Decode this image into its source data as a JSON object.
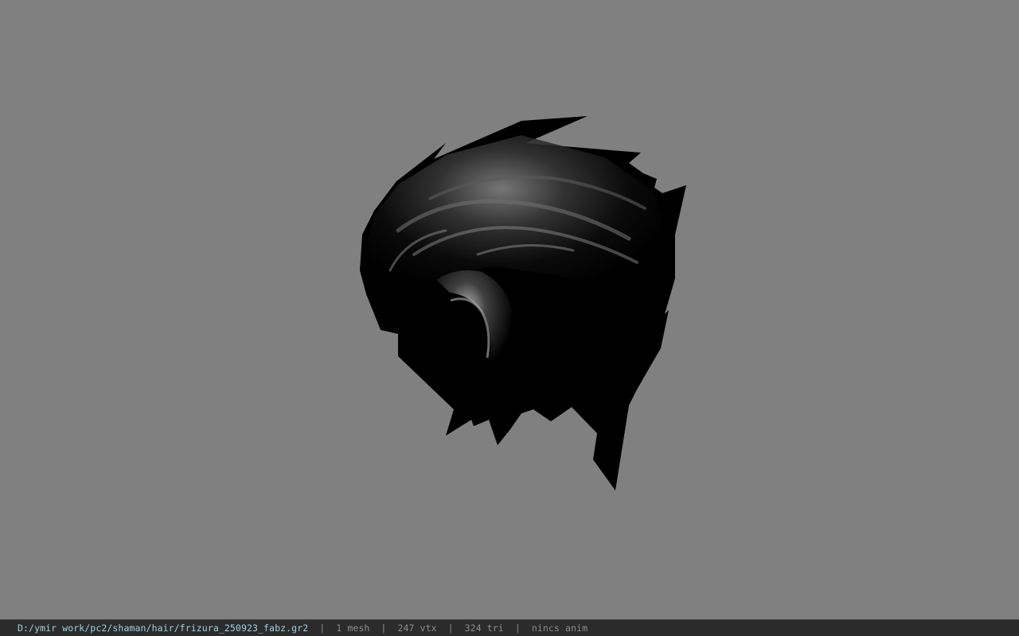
{
  "viewport": {
    "background": "#808080",
    "model": "hair mesh"
  },
  "status_bar": {
    "file_path": "D:/ymir work/pc2/shaman/hair/frizura_250923_fabz.gr2",
    "separator": "|",
    "mesh_count": "1 mesh",
    "vertex_count": "247 vtx",
    "triangle_count": "324 tri",
    "animation": "nincs anim",
    "path_color": "#9fd0e6"
  }
}
